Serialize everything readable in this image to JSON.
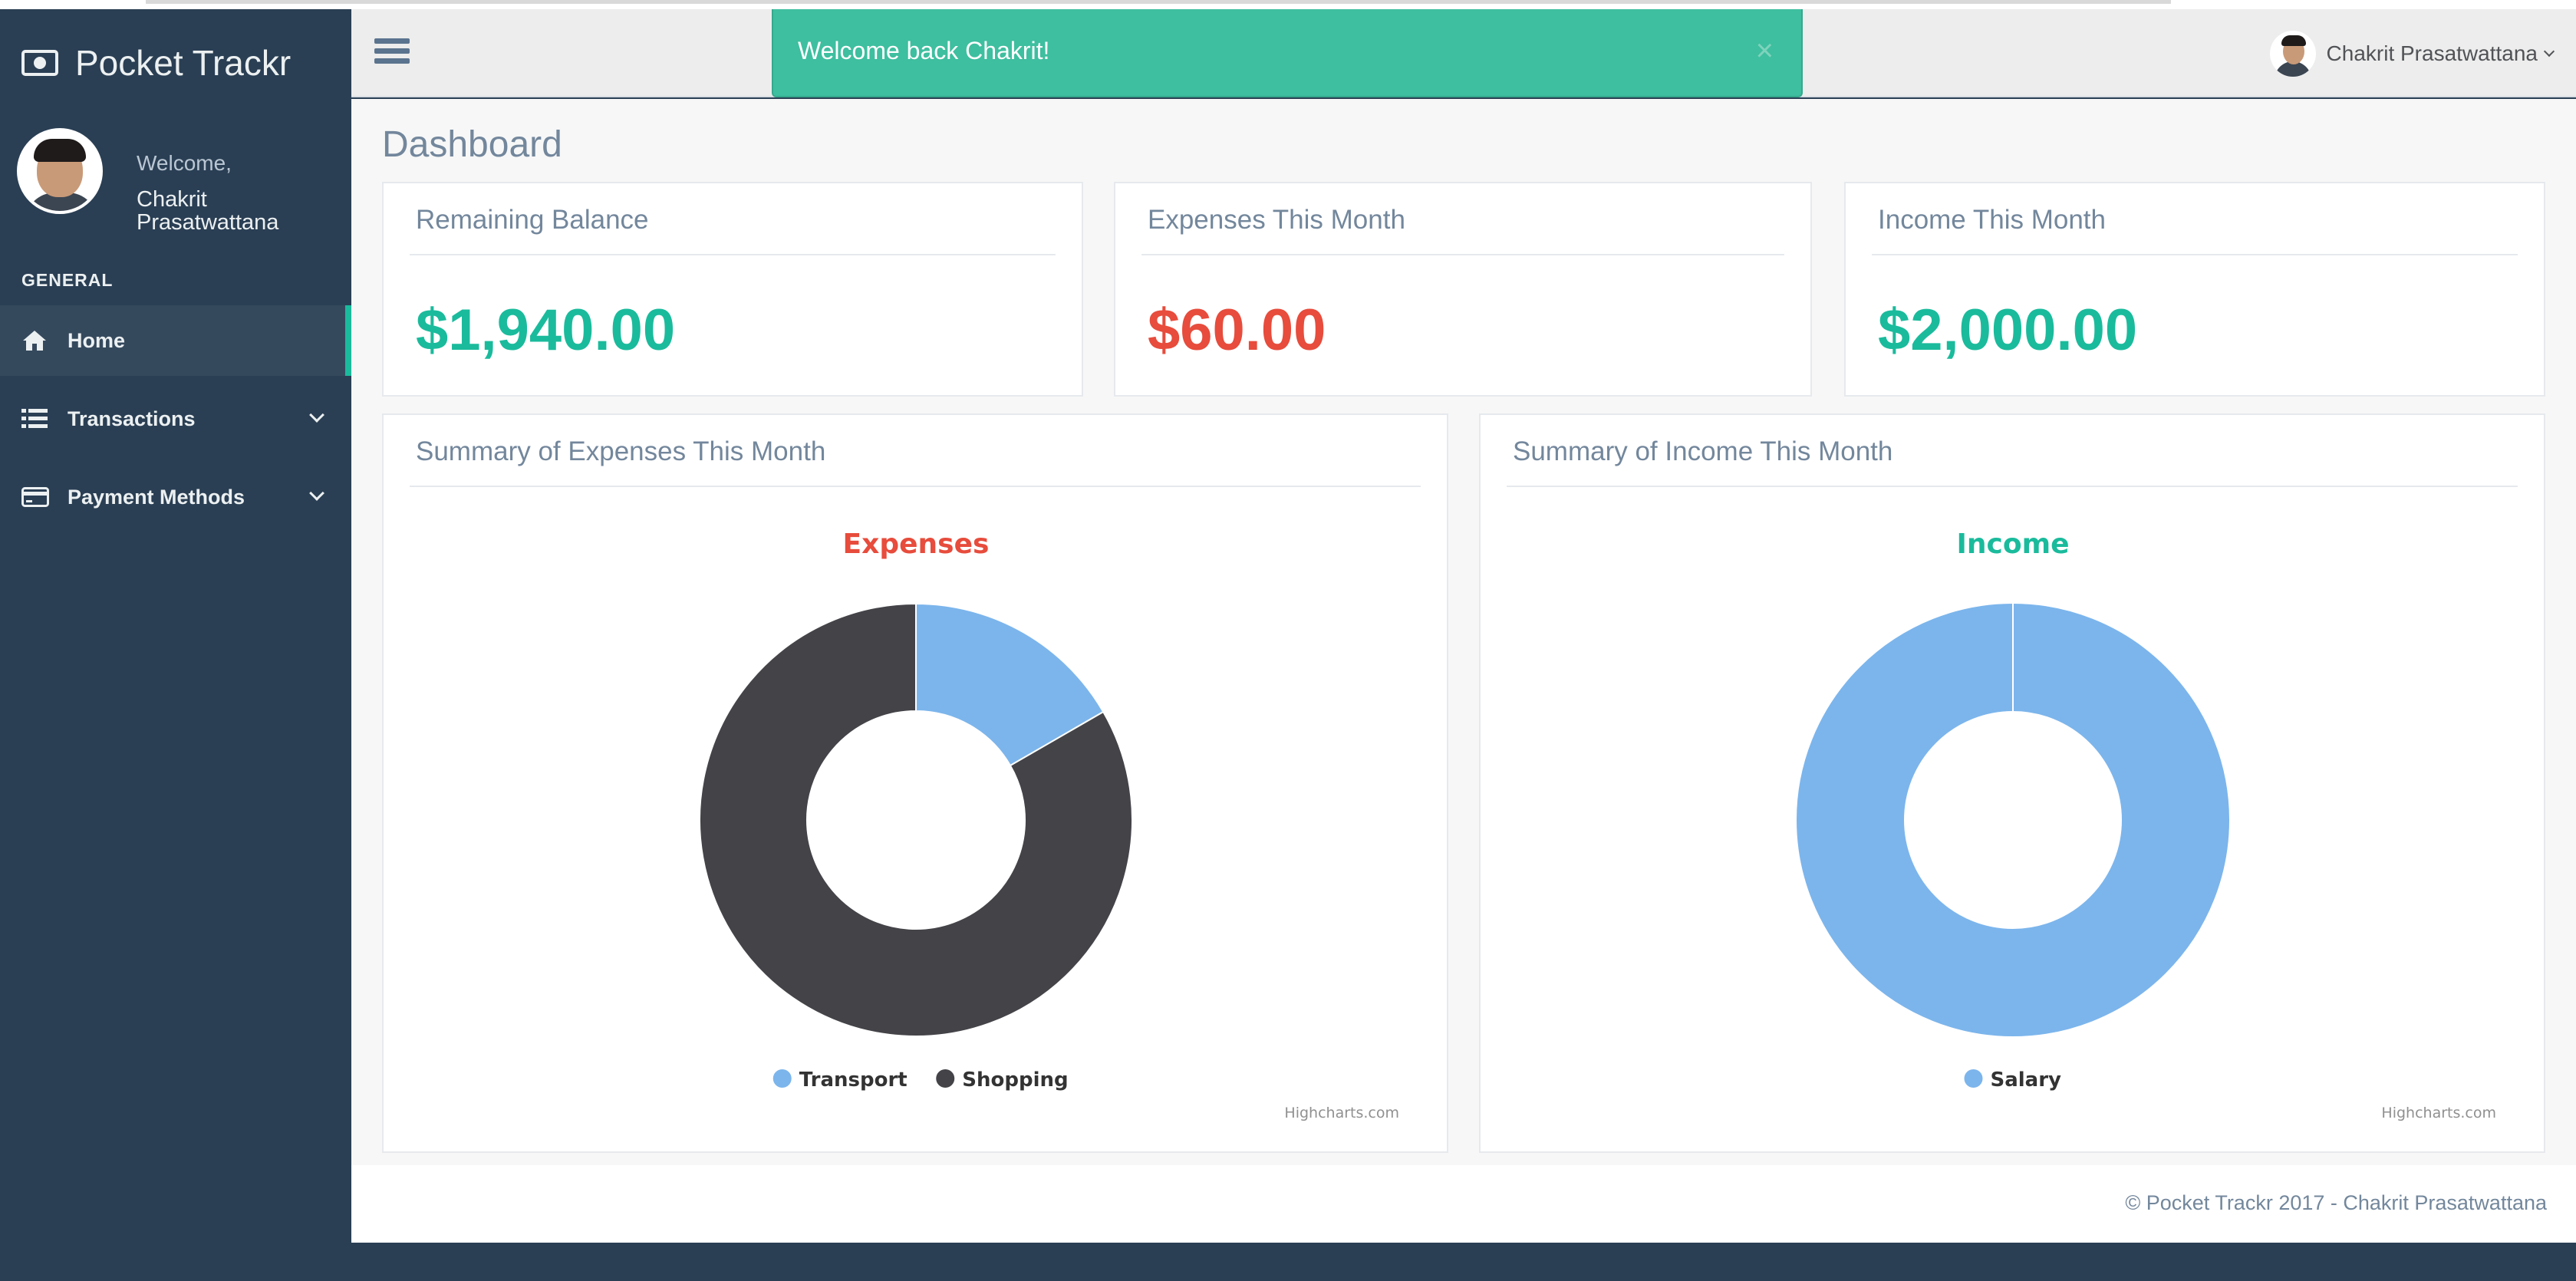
{
  "app": {
    "brand": "Pocket Trackr"
  },
  "sidebar": {
    "welcome": "Welcome,",
    "user_name": "Chakrit Prasatwattana",
    "section": "GENERAL",
    "items": [
      {
        "label": "Home",
        "icon": "home-icon",
        "active": true
      },
      {
        "label": "Transactions",
        "icon": "list-icon",
        "expandable": true
      },
      {
        "label": "Payment Methods",
        "icon": "credit-card-icon",
        "expandable": true
      }
    ]
  },
  "topnav": {
    "user_name": "Chakrit Prasatwattana"
  },
  "notification": {
    "text": "Welcome back Chakrit!",
    "close": "×"
  },
  "page": {
    "title": "Dashboard"
  },
  "stats": [
    {
      "title": "Remaining Balance",
      "value": "$1,940.00",
      "color": "#1abb9c"
    },
    {
      "title": "Expenses This Month",
      "value": "$60.00",
      "color": "#e74c3c"
    },
    {
      "title": "Income This Month",
      "value": "$2,000.00",
      "color": "#1abb9c"
    }
  ],
  "panels": {
    "expenses_title": "Summary of Expenses This Month",
    "income_title": "Summary of Income This Month"
  },
  "chart_data": [
    {
      "type": "pie",
      "title": "Expenses",
      "title_color": "#e74c3c",
      "categories": [
        "Transport",
        "Shopping"
      ],
      "values": [
        10,
        50
      ],
      "colors": [
        "#7cb5ec",
        "#434348"
      ],
      "legend": "bottom-center",
      "credit": "Highcharts.com"
    },
    {
      "type": "pie",
      "title": "Income",
      "title_color": "#1abb9c",
      "categories": [
        "Salary"
      ],
      "values": [
        2000
      ],
      "colors": [
        "#7cb5ec"
      ],
      "legend": "bottom-center",
      "credit": "Highcharts.com"
    }
  ],
  "footer": {
    "text": "© Pocket Trackr 2017 - Chakrit Prasatwattana"
  }
}
